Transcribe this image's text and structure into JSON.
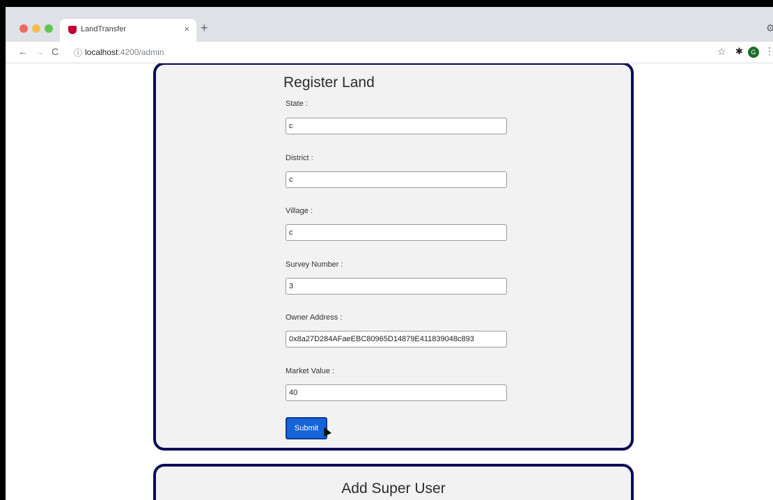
{
  "browser": {
    "tab_title": "LandTransfer",
    "tab_close": "×",
    "new_tab": "+",
    "url_host": "localhost",
    "url_path": ":4200/admin",
    "icons": {
      "back": "arrow-left-icon",
      "forward": "arrow-right-icon",
      "reload": "reload-icon",
      "site_info": "info-icon",
      "bookmark": "star-icon",
      "extensions": "puzzle-icon",
      "menu": "kebab-menu-icon"
    },
    "profile_initial": "G"
  },
  "register_land": {
    "title": "Register Land",
    "fields": [
      {
        "label": "State :",
        "value": "c"
      },
      {
        "label": "District :",
        "value": "c"
      },
      {
        "label": "Village :",
        "value": "c"
      },
      {
        "label": "Survey Number :",
        "value": "3"
      },
      {
        "label": "Owner Address :",
        "value": "0x8a27D284AFaeEBC80965D14879E411839048c893"
      },
      {
        "label": "Market Value :",
        "value": "40"
      }
    ],
    "submit_label": "Submit"
  },
  "add_super_user": {
    "title": "Add Super User"
  },
  "colors": {
    "card_border": "#0c0c5a",
    "submit": "#1565d8"
  }
}
